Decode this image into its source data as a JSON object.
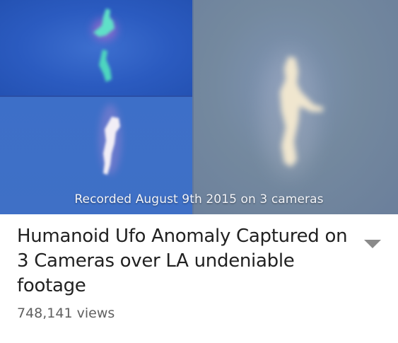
{
  "video": {
    "thumbnail_caption": "Recorded August 9th 2015 on 3 cameras",
    "title": "Humanoid Ufo Anomaly Captured on 3 Cameras over LA undeniable footage",
    "views": "748,141 views",
    "menu_icon": "chevron-down-icon"
  }
}
